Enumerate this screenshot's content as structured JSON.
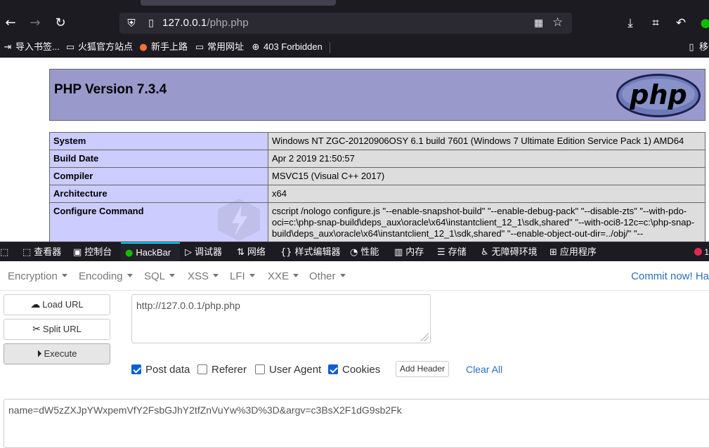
{
  "browser": {
    "url_host": "127.0.0.1",
    "url_path": "/php.php",
    "bookmarks": [
      {
        "label": "导入书签..."
      },
      {
        "label": "火狐官方站点"
      },
      {
        "label": "新手上路"
      },
      {
        "label": "常用网址"
      },
      {
        "label": "403 Forbidden"
      },
      {
        "label": "移动"
      }
    ]
  },
  "phpinfo": {
    "title": "PHP Version 7.3.4",
    "logo_text": "php",
    "rows": [
      {
        "key": "System",
        "value": "Windows NT ZGC-20120906OSY 6.1 build 7601 (Windows 7 Ultimate Edition Service Pack 1) AMD64"
      },
      {
        "key": "Build Date",
        "value": "Apr 2 2019 21:50:57"
      },
      {
        "key": "Compiler",
        "value": "MSVC15 (Visual C++ 2017)"
      },
      {
        "key": "Architecture",
        "value": "x64"
      },
      {
        "key": "Configure Command",
        "value": "cscript /nologo configure.js \"--enable-snapshot-build\" \"--enable-debug-pack\" \"--disable-zts\" \"--with-pdo-oci=c:\\php-snap-build\\deps_aux\\oracle\\x64\\instantclient_12_1\\sdk,shared\" \"--with-oci8-12c=c:\\php-snap-build\\deps_aux\\oracle\\x64\\instantclient_12_1\\sdk,shared\" \"--enable-object-out-dir=../obj/\" \"--"
      }
    ]
  },
  "devtools": {
    "tabs": [
      "查看器",
      "控制台",
      "HackBar",
      "调试器",
      "网络",
      "样式编辑器",
      "性能",
      "内存",
      "存储",
      "无障碍环境",
      "应用程序"
    ],
    "active_tab": "HackBar",
    "error_count": "1"
  },
  "hackbar": {
    "menu": [
      "Encryption",
      "Encoding",
      "SQL",
      "XSS",
      "LFI",
      "XXE",
      "Other"
    ],
    "commit": "Commit now! Ha",
    "buttons": {
      "load": "Load URL",
      "split": "Split URL",
      "execute": "Execute"
    },
    "url_value": "http://127.0.0.1/php.php",
    "checks": [
      {
        "label": "Post data",
        "checked": true
      },
      {
        "label": "Referer",
        "checked": false
      },
      {
        "label": "User Agent",
        "checked": false
      },
      {
        "label": "Cookies",
        "checked": true
      }
    ],
    "add_header": "Add Header",
    "clear_all": "Clear All",
    "post_value": "name=dW5zZXJpYWxpemVfY2FsbGJhY2tfZnVuYw%3D%3D&argv=c3BsX2F1dG9sb2Fk"
  },
  "colors": {
    "php_header_bg": "#9999cc",
    "php_key_bg": "#ccccff",
    "php_value_bg": "#dddddd",
    "chrome_bg": "#1c1b22",
    "active_tab_accent": "#00ddff",
    "link_blue": "#2a6fb5",
    "checkbox_blue": "#0a5fd6"
  },
  "icons": [
    "back-arrow-icon",
    "forward-arrow-icon",
    "reload-icon",
    "shield-icon",
    "page-icon",
    "qr-code-icon",
    "star-icon",
    "download-icon",
    "crop-icon",
    "undo-icon",
    "extension-icon",
    "import-icon",
    "folder-icon",
    "firefox-icon",
    "globe-icon",
    "mobile-icon",
    "cloud-download-icon",
    "scissors-icon",
    "play-icon"
  ]
}
